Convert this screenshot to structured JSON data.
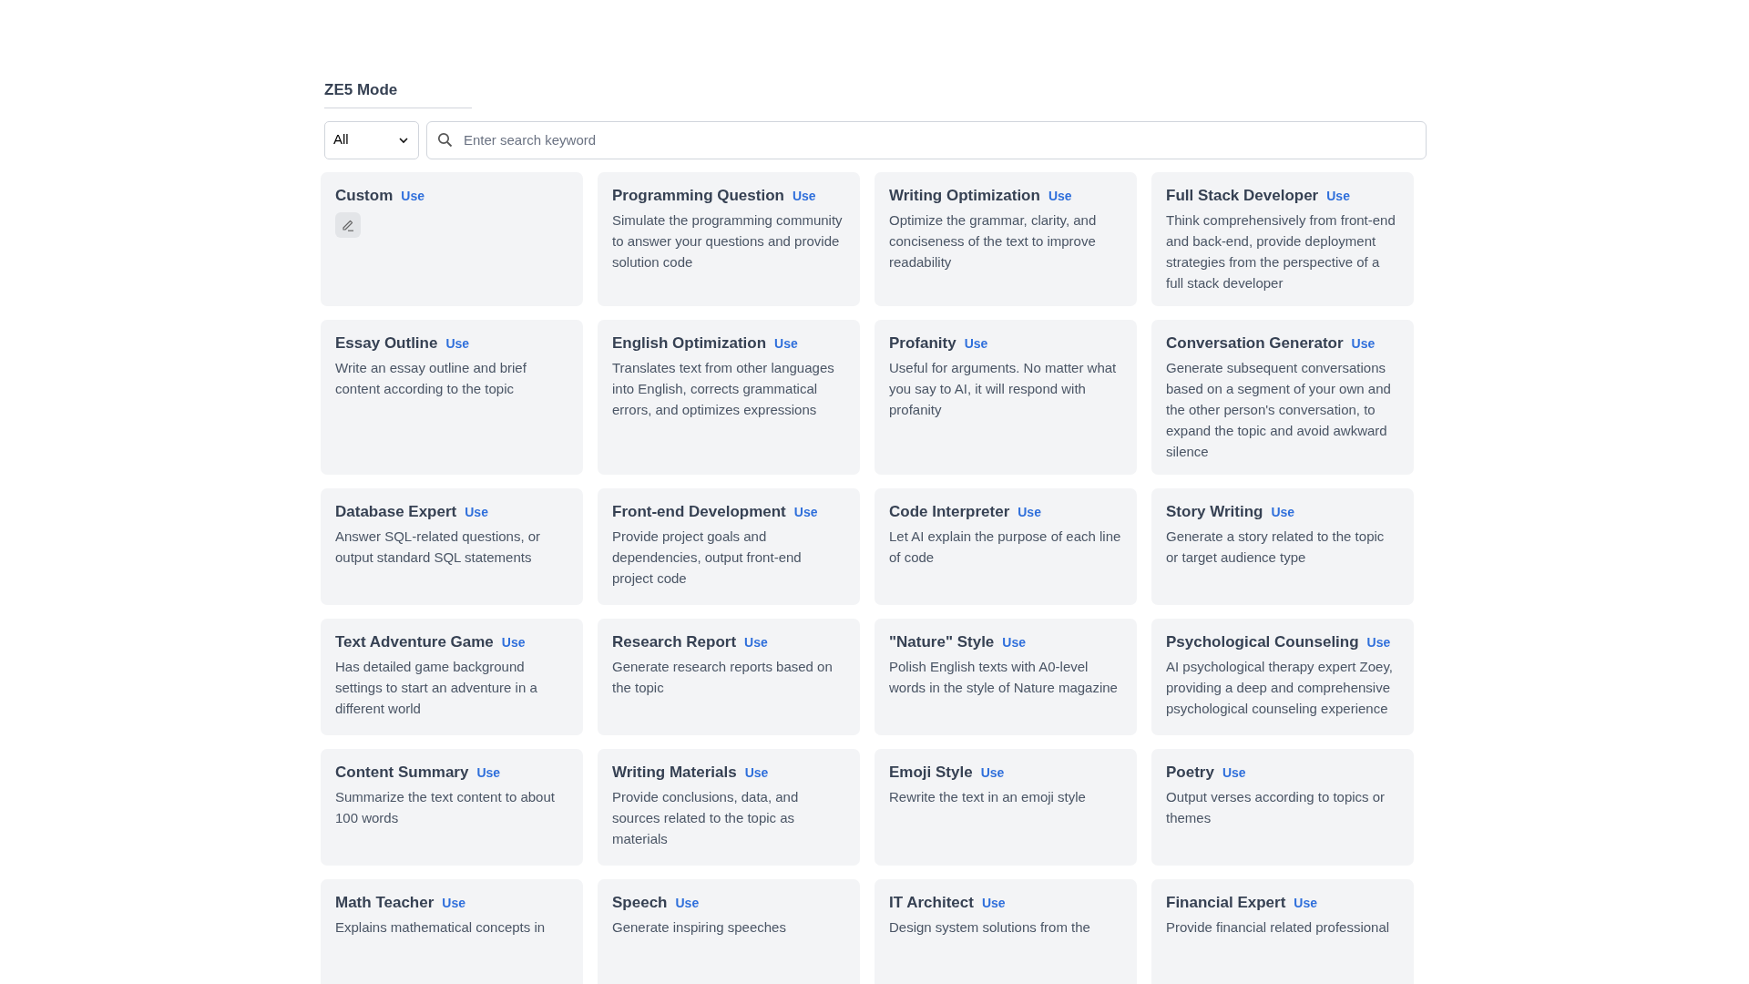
{
  "header": {
    "title": "ZE5 Mode"
  },
  "filter": {
    "value": "All"
  },
  "search": {
    "placeholder": "Enter search keyword"
  },
  "cards": [
    {
      "kind": "custom",
      "title": "Custom",
      "action": "Use"
    },
    {
      "kind": "preset",
      "title": "Programming Question",
      "action": "Use",
      "description": "Simulate the programming community to answer your questions and provide solution code"
    },
    {
      "kind": "preset",
      "title": "Writing Optimization",
      "action": "Use",
      "description": "Optimize the grammar, clarity, and conciseness of the text to improve readability"
    },
    {
      "kind": "preset",
      "title": "Full Stack Developer",
      "action": "Use",
      "description": "Think comprehensively from front-end and back-end, provide deployment strategies from the perspective of a full stack developer"
    },
    {
      "kind": "preset",
      "title": "Essay Outline",
      "action": "Use",
      "description": "Write an essay outline and brief content according to the topic"
    },
    {
      "kind": "preset",
      "title": "English Optimization",
      "action": "Use",
      "description": "Translates text from other languages into English, corrects grammatical errors, and optimizes expressions"
    },
    {
      "kind": "preset",
      "title": "Profanity",
      "action": "Use",
      "description": "Useful for arguments. No matter what you say to AI, it will respond with profanity"
    },
    {
      "kind": "preset",
      "title": "Conversation Generator",
      "action": "Use",
      "description": "Generate subsequent conversations based on a segment of your own and the other person's conversation, to expand the topic and avoid awkward silence"
    },
    {
      "kind": "preset",
      "title": "Database Expert",
      "action": "Use",
      "description": "Answer SQL-related questions, or output standard SQL statements"
    },
    {
      "kind": "preset",
      "title": "Front-end Development",
      "action": "Use",
      "description": "Provide project goals and dependencies, output front-end project code"
    },
    {
      "kind": "preset",
      "title": "Code Interpreter",
      "action": "Use",
      "description": "Let AI explain the purpose of each line of code"
    },
    {
      "kind": "preset",
      "title": "Story Writing",
      "action": "Use",
      "description": "Generate a story related to the topic or target audience type"
    },
    {
      "kind": "preset",
      "title": "Text Adventure Game",
      "action": "Use",
      "description": "Has detailed game background settings to start an adventure in a different world"
    },
    {
      "kind": "preset",
      "title": "Research Report",
      "action": "Use",
      "description": "Generate research reports based on the topic"
    },
    {
      "kind": "preset",
      "title": "\"Nature\" Style",
      "action": "Use",
      "description": "Polish English texts with A0-level words in the style of Nature magazine"
    },
    {
      "kind": "preset",
      "title": "Psychological Counseling",
      "action": "Use",
      "description": "AI psychological therapy expert Zoey, providing a deep and comprehensive psychological counseling experience"
    },
    {
      "kind": "preset",
      "title": "Content Summary",
      "action": "Use",
      "description": "Summarize the text content to about 100 words"
    },
    {
      "kind": "preset",
      "title": "Writing Materials",
      "action": "Use",
      "description": "Provide conclusions, data, and sources related to the topic as materials"
    },
    {
      "kind": "preset",
      "title": "Emoji Style",
      "action": "Use",
      "description": "Rewrite the text in an emoji style"
    },
    {
      "kind": "preset",
      "title": "Poetry",
      "action": "Use",
      "description": "Output verses according to topics or themes"
    },
    {
      "kind": "preset",
      "title": "Math Teacher",
      "action": "Use",
      "description": "Explains mathematical concepts in"
    },
    {
      "kind": "preset",
      "title": "Speech",
      "action": "Use",
      "description": "Generate inspiring speeches"
    },
    {
      "kind": "preset",
      "title": "IT Architect",
      "action": "Use",
      "description": "Design system solutions from the"
    },
    {
      "kind": "preset",
      "title": "Financial Expert",
      "action": "Use",
      "description": "Provide financial related professional"
    }
  ]
}
